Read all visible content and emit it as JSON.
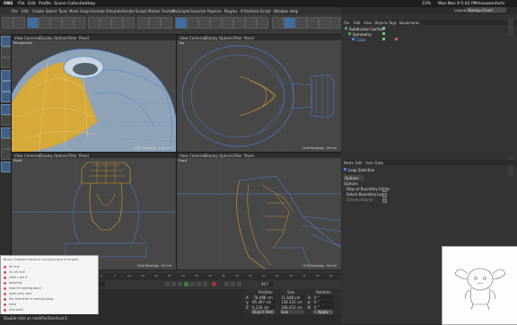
{
  "mac_menubar": {
    "app": "OBS",
    "items": [
      "File",
      "Edit",
      "Profile",
      "Scene Collection",
      "Help"
    ],
    "right_status": [
      "23%",
      "Mon Nov 9 5:42 PM",
      "Hexaeonforts"
    ]
  },
  "app_menu": {
    "items": [
      "File",
      "Edit",
      "Create",
      "Select",
      "Tools",
      "Mesh",
      "Snap",
      "Animate",
      "Simulate",
      "Render",
      "Sculpt",
      "Motion Tracker",
      "MoGraph",
      "Character",
      "Pipeline",
      "Plugins",
      "X-Particles",
      "Script",
      "Window",
      "Help"
    ]
  },
  "viewports": [
    {
      "name": "Perspective",
      "menu": [
        "View",
        "Cameras",
        "Display",
        "Options",
        "Filter",
        "Panel"
      ],
      "grid_spacing": "Grid Spacing : 1.00 cm"
    },
    {
      "name": "Top",
      "menu": [
        "View",
        "Cameras",
        "Display",
        "Options",
        "Filter",
        "Panel"
      ],
      "grid_spacing": "Grid Spacing : 10 cm"
    },
    {
      "name": "Right",
      "menu": [
        "View",
        "Cameras",
        "Display",
        "Options",
        "Filter",
        "Panel"
      ],
      "grid_spacing": "Grid Spacing : 10 cm"
    },
    {
      "name": "Front",
      "menu": [
        "View",
        "Cameras",
        "Display",
        "Options",
        "Filter",
        "Panel"
      ],
      "grid_spacing": "Grid Spacing : 10 cm"
    }
  ],
  "object_manager": {
    "menu": [
      "File",
      "Edit",
      "View",
      "Objects",
      "Tags",
      "Bookmarks"
    ],
    "layout_label": "Layout:",
    "layout_value": "Startup (User)",
    "objects": [
      "Subdivision Surface",
      "Symmetry",
      "Cube"
    ]
  },
  "attribute_manager": {
    "menu": [
      "Mode",
      "Edit",
      "User Data"
    ],
    "title": "Loop Selection",
    "tab": "Options",
    "section": "Options",
    "options": [
      "Stop at Boundary Edges",
      "Select Boundary Loop",
      "Greedy Search"
    ]
  },
  "timeline": {
    "ticks": [
      "0",
      "5",
      "10",
      "15",
      "20",
      "25",
      "30",
      "35",
      "40",
      "45",
      "50",
      "55",
      "60",
      "65",
      "70",
      "75",
      "80",
      "85",
      "90"
    ],
    "frame_start": "0 F",
    "frame_end": "90 F"
  },
  "coordinates": {
    "headers": [
      "Position",
      "Size",
      "Rotation"
    ],
    "rows": [
      {
        "axis": "X",
        "pos": "-78.496 cm",
        "size": "11.648 cm",
        "rot_axis": "H",
        "rot": "0 °"
      },
      {
        "axis": "Y",
        "pos": "65.397 cm",
        "size": "138.335 cm",
        "rot_axis": "P",
        "rot": "0 °"
      },
      {
        "axis": "Z",
        "pos": "6.234 cm",
        "size": "108.453 cm",
        "rot_axis": "B",
        "rot": "0 °"
      }
    ],
    "mode": "Object (Rel)",
    "size_mode": "Size",
    "apply": "Apply"
  },
  "obs_chat": {
    "header": "Blocks | inspector:Vibrance: looking forward to tonights",
    "rows": [
      "ok nice",
      "lol, ok nice",
      "yeah I see it",
      "amazing",
      "wow it's looking good",
      "looks very cool",
      "the character is coming along",
      "haha",
      "nice work"
    ]
  },
  "status_text": "Double-click on modifier/Shortcut E",
  "colors": {
    "viewport": "#474747",
    "wire_blue": "#4a7fd4",
    "wire_orange": "#e0a020",
    "accent_blue": "#3d6ea6"
  }
}
